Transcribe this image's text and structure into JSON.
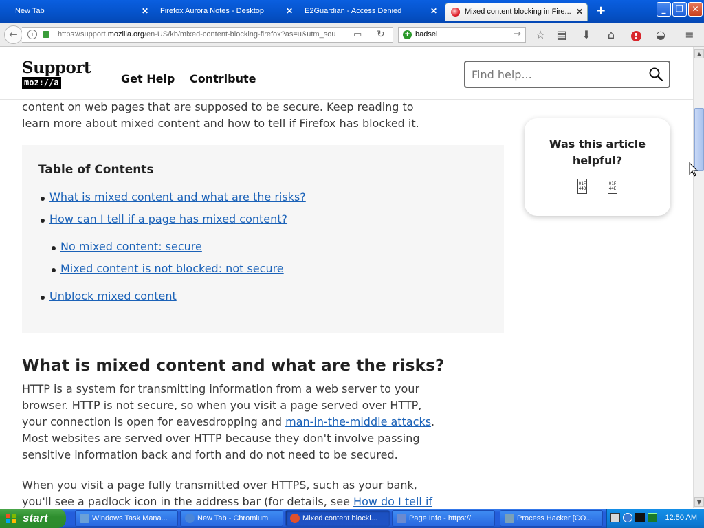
{
  "tabs": [
    {
      "label": "New Tab"
    },
    {
      "label": "Firefox Aurora Notes - Desktop"
    },
    {
      "label": "E2Guardian - Access Denied"
    },
    {
      "label": "Mixed content blocking in Fire..."
    }
  ],
  "window_controls": {
    "minimize": "_",
    "maximize": "❐",
    "close": "✕"
  },
  "nav": {
    "url_prefix": "https://support.",
    "url_domain": "mozilla.org",
    "url_rest": "/en-US/kb/mixed-content-blocking-firefox?as=u&utm_sou",
    "search_value": "badsel"
  },
  "site": {
    "logo_word": "Support",
    "logo_brand": "moz://a",
    "nav_links": [
      "Get Help",
      "Contribute"
    ],
    "search_placeholder": "Find help..."
  },
  "article": {
    "intro": "content on web pages that are supposed to be secure. Keep reading to learn more about mixed content and how to tell if Firefox has blocked it.",
    "toc_title": "Table of Contents",
    "toc": [
      "What is mixed content and what are the risks?",
      "How can I tell if a page has mixed content?",
      "No mixed content: secure",
      "Mixed content is not blocked: not secure",
      "Unblock mixed content"
    ],
    "heading": "What is mixed content and what are the risks?",
    "para1_a": "HTTP is a system for transmitting information from a web server to your browser. HTTP is not secure, so when you visit a page served over HTTP, your connection is open for eavesdropping and ",
    "para1_link": "man-in-the-middle attacks",
    "para1_b": ". Most websites are served over HTTP because they don't involve passing sensitive information back and forth and do not need to be secured.",
    "para2_a": "When you visit a page fully transmitted over HTTPS, such as your bank, you'll see a padlock icon  in the address bar (for details, see ",
    "para2_link": "How do I tell if my"
  },
  "helpful": {
    "question": "Was this article helpful?",
    "yes_glyph": "01F 44D",
    "no_glyph": "01F 44E"
  },
  "taskbar": {
    "start": "start",
    "tasks": [
      {
        "label": "Windows Task Mana...",
        "color": "#6aa0d8"
      },
      {
        "label": "New Tab - Chromium",
        "color": "#4a86d8"
      },
      {
        "label": "Mixed content blocki...",
        "color": "#e0502a"
      },
      {
        "label": "Page Info - https://...",
        "color": "#6a8ad0"
      },
      {
        "label": "Process Hacker [CO...",
        "color": "#7aa0b8"
      }
    ],
    "clock": "12:50 AM"
  }
}
